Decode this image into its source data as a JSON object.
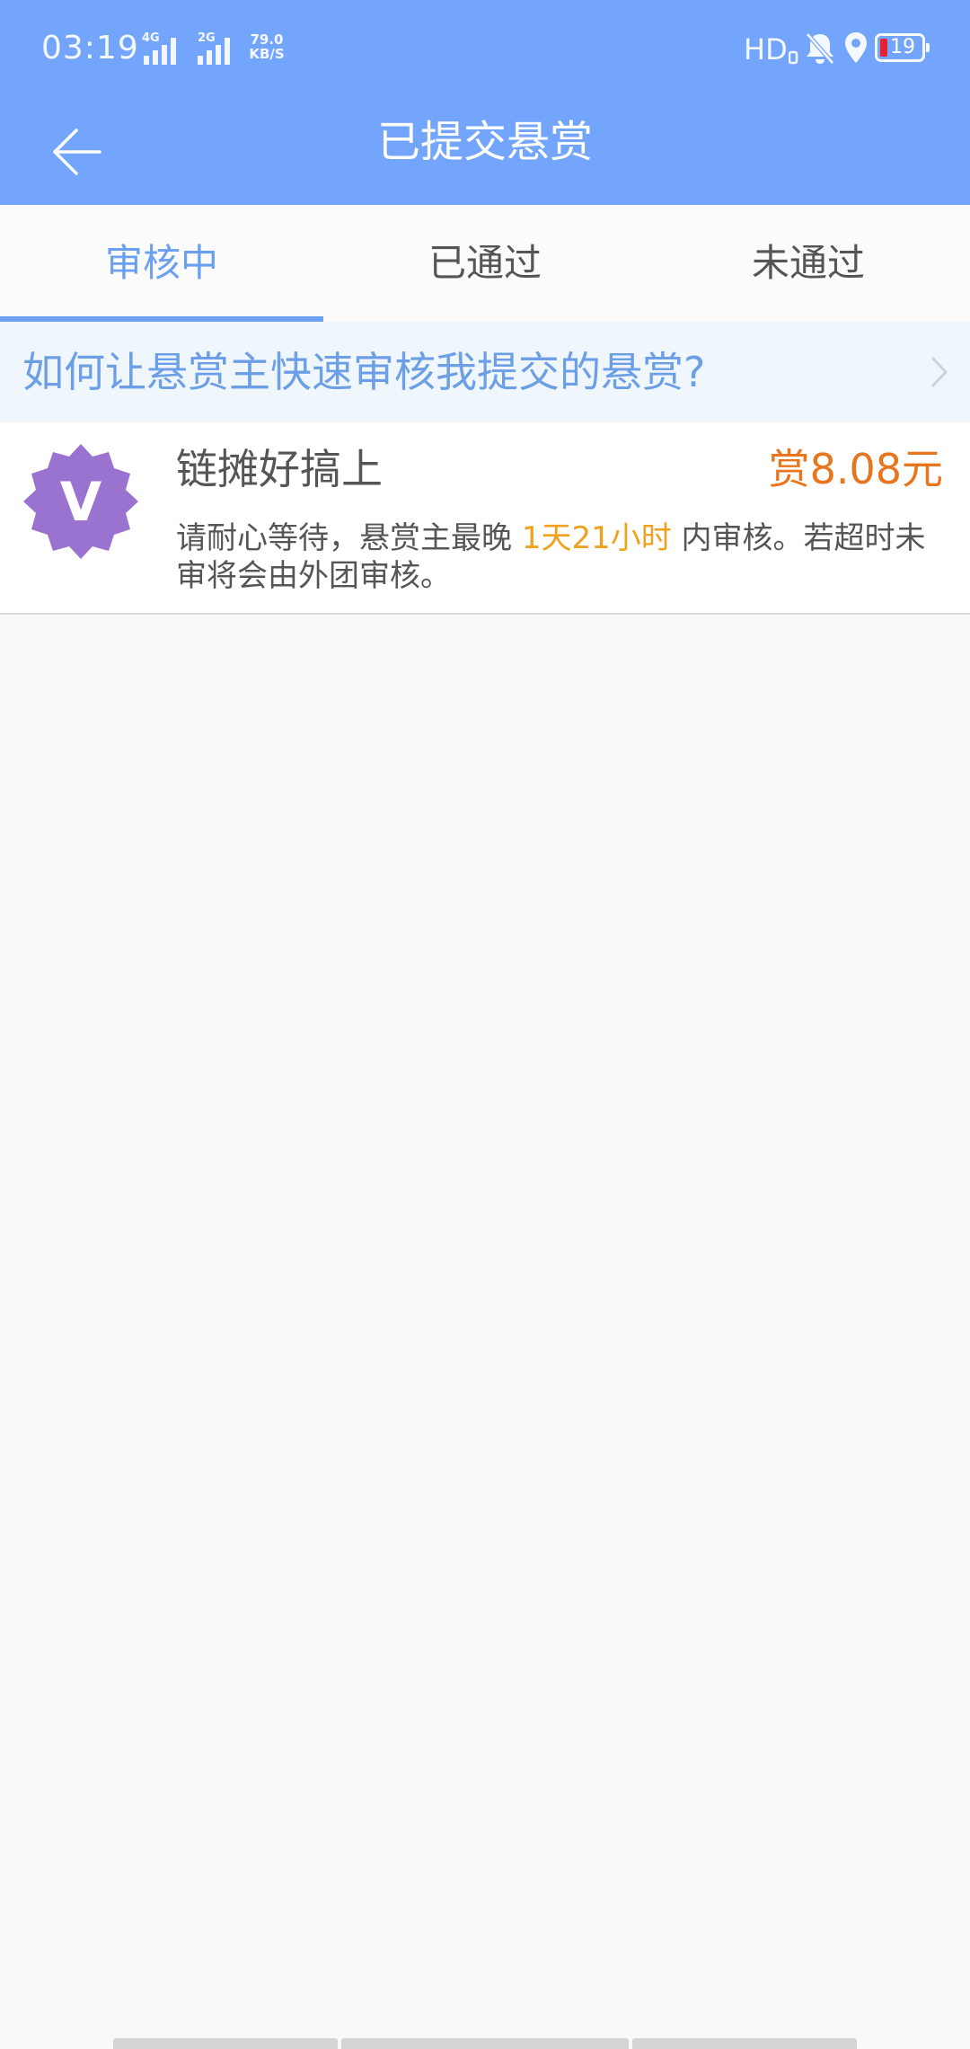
{
  "status_bar": {
    "time": "03:19",
    "network_1": "4G",
    "network_2": "2G",
    "speed_value": "79.0",
    "speed_unit": "KB/S",
    "hd": "HD",
    "battery": "19",
    "icons": [
      "mute-bell-icon",
      "location-icon",
      "battery-icon"
    ]
  },
  "toolbar": {
    "back_icon": "arrow-left-icon",
    "title": "已提交悬赏"
  },
  "tabs": [
    {
      "label": "审核中",
      "active": true
    },
    {
      "label": "已通过",
      "active": false
    },
    {
      "label": "未通过",
      "active": false
    }
  ],
  "help_banner": {
    "text": "如何让悬赏主快速审核我提交的悬赏?",
    "icon": "chevron-right-icon"
  },
  "tasks": [
    {
      "avatar_letter": "V",
      "title": "链摊好搞上",
      "reward": "赏8.08元",
      "desc_prefix": "请耐心等待，悬赏主最晚 ",
      "desc_highlight": "1天21小时",
      "desc_suffix": " 内审核。若超时未审将会由外团审核。"
    }
  ],
  "colors": {
    "header": "#73a5fd",
    "accent": "#6b9ff0",
    "reward": "#e8761e",
    "highlight": "#f0a21e",
    "avatar": "#9a72cf"
  }
}
